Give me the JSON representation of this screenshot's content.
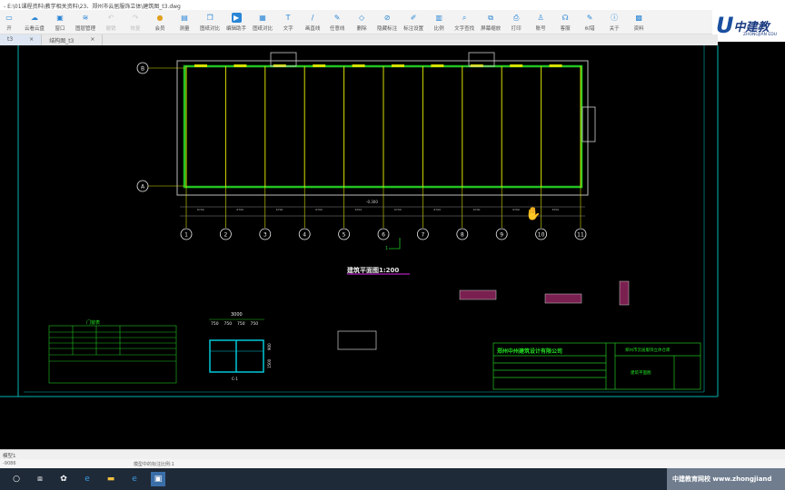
{
  "window": {
    "title": "- E:\\01课程资料\\教学相关资料\\23、郑州市云居服饰立体\\建筑图_t3.dwg"
  },
  "toolbar": {
    "items": [
      {
        "label": "开",
        "icon": "open-icon"
      },
      {
        "label": "云看云盘",
        "icon": "cloud-icon"
      },
      {
        "label": "窗口",
        "icon": "window-icon"
      },
      {
        "label": "图层管理",
        "icon": "layers-icon"
      },
      {
        "label": "撤销",
        "icon": "undo-icon",
        "disabled": true
      },
      {
        "label": "恢复",
        "icon": "redo-icon",
        "disabled": true
      },
      {
        "label": "会员",
        "icon": "vip-icon"
      },
      {
        "label": "测量",
        "icon": "measure-icon"
      },
      {
        "label": "图纸对比",
        "icon": "compare-icon"
      },
      {
        "label": "编辑助手",
        "icon": "edit-assistant-icon"
      },
      {
        "label": "图纸对比",
        "icon": "drawing-compare-icon"
      },
      {
        "label": "文字",
        "icon": "text-icon"
      },
      {
        "label": "画直线",
        "icon": "line-icon"
      },
      {
        "label": "任意线",
        "icon": "freehand-icon"
      },
      {
        "label": "删除",
        "icon": "eraser-icon"
      },
      {
        "label": "隐藏标注",
        "icon": "hide-icon"
      },
      {
        "label": "标注设置",
        "icon": "annotation-settings-icon"
      },
      {
        "label": "比例",
        "icon": "scale-icon"
      },
      {
        "label": "文字查找",
        "icon": "text-search-icon"
      },
      {
        "label": "屏幕缩放",
        "icon": "zoom-icon"
      },
      {
        "label": "打印",
        "icon": "print-icon"
      },
      {
        "label": "账号",
        "icon": "account-icon"
      },
      {
        "label": "客服",
        "icon": "support-icon"
      },
      {
        "label": "纠错",
        "icon": "feedback-icon"
      },
      {
        "label": "关于",
        "icon": "about-icon"
      },
      {
        "label": "资料",
        "icon": "resources-icon"
      }
    ]
  },
  "logo": {
    "name": "中建教",
    "sub": "ZHONGJIAN EDU"
  },
  "tabs": [
    {
      "label": "t3",
      "close": "×"
    },
    {
      "label": "结构图_t3",
      "close": "×"
    }
  ],
  "drawing": {
    "axes_x": [
      "1",
      "2",
      "3",
      "4",
      "5",
      "6",
      "7",
      "8",
      "9",
      "10",
      "11"
    ],
    "axes_y": [
      "B",
      "A"
    ],
    "plan_title": "建筑平面图1:200",
    "section_mark": "1",
    "window_width": "3000",
    "window_parts": [
      "750",
      "750",
      "750",
      "750"
    ],
    "window_heights": [
      "900",
      "1500"
    ],
    "window_label": "C-1",
    "door_table_title": "门窗表",
    "company": "郑州中州建筑设计有限公司",
    "project": "郑州市云居服饰立体仓库",
    "sheet": "建筑平面图",
    "dim_span": "6700",
    "elevation": "-0.300"
  },
  "colors": {
    "wall": "#22c322",
    "column": "#d8e000",
    "frame": "#00b4b4",
    "text": "#22e022",
    "window": "#00c8d8",
    "accent": "#b020c0"
  },
  "layout_tab": "模型1",
  "status": {
    "coords": "-9086",
    "scale": "模型中的标注比例:1"
  },
  "taskbar": {
    "icons": [
      "search-icon",
      "task-view-icon",
      "app-icon",
      "ie-icon",
      "folder-icon",
      "edge-icon",
      "cad-icon"
    ],
    "tray_text": "中建教育网校  www.zhongjiand"
  }
}
